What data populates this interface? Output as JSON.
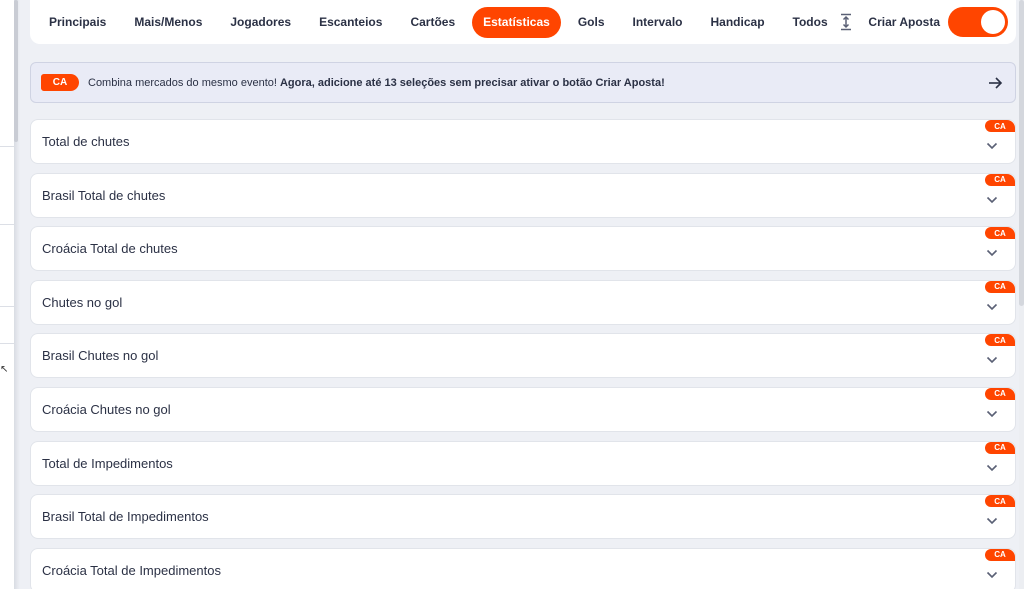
{
  "tabs": [
    {
      "label": "Principais",
      "active": false
    },
    {
      "label": "Mais/Menos",
      "active": false
    },
    {
      "label": "Jogadores",
      "active": false
    },
    {
      "label": "Escanteios",
      "active": false
    },
    {
      "label": "Cartões",
      "active": false
    },
    {
      "label": "Estatísticas",
      "active": true
    },
    {
      "label": "Gols",
      "active": false
    },
    {
      "label": "Intervalo",
      "active": false
    },
    {
      "label": "Handicap",
      "active": false
    },
    {
      "label": "Todos",
      "active": false
    }
  ],
  "create_bet": {
    "label": "Criar Aposta",
    "enabled": true
  },
  "banner": {
    "badge": "CA",
    "text": "Combina mercados do mesmo evento! ",
    "bold_text": "Agora, adicione até 13 seleções sem precisar ativar o botão Criar Aposta!"
  },
  "markets": [
    {
      "title": "Total de chutes",
      "badge": "CA"
    },
    {
      "title": "Brasil Total de chutes",
      "badge": "CA"
    },
    {
      "title": "Croácia Total de chutes",
      "badge": "CA"
    },
    {
      "title": "Chutes no gol",
      "badge": "CA"
    },
    {
      "title": "Brasil Chutes no gol",
      "badge": "CA"
    },
    {
      "title": "Croácia Chutes no gol",
      "badge": "CA"
    },
    {
      "title": "Total de Impedimentos",
      "badge": "CA"
    },
    {
      "title": "Brasil Total de Impedimentos",
      "badge": "CA"
    },
    {
      "title": "Croácia Total de Impedimentos",
      "badge": "CA"
    }
  ],
  "colors": {
    "accent": "#ff4500",
    "text": "#2b3145",
    "banner_bg": "#e9ebf6"
  },
  "icons": {
    "bet_builder": "bet-builder-icon",
    "arrow": "arrow-right-icon",
    "chevron": "chevron-down-icon"
  }
}
